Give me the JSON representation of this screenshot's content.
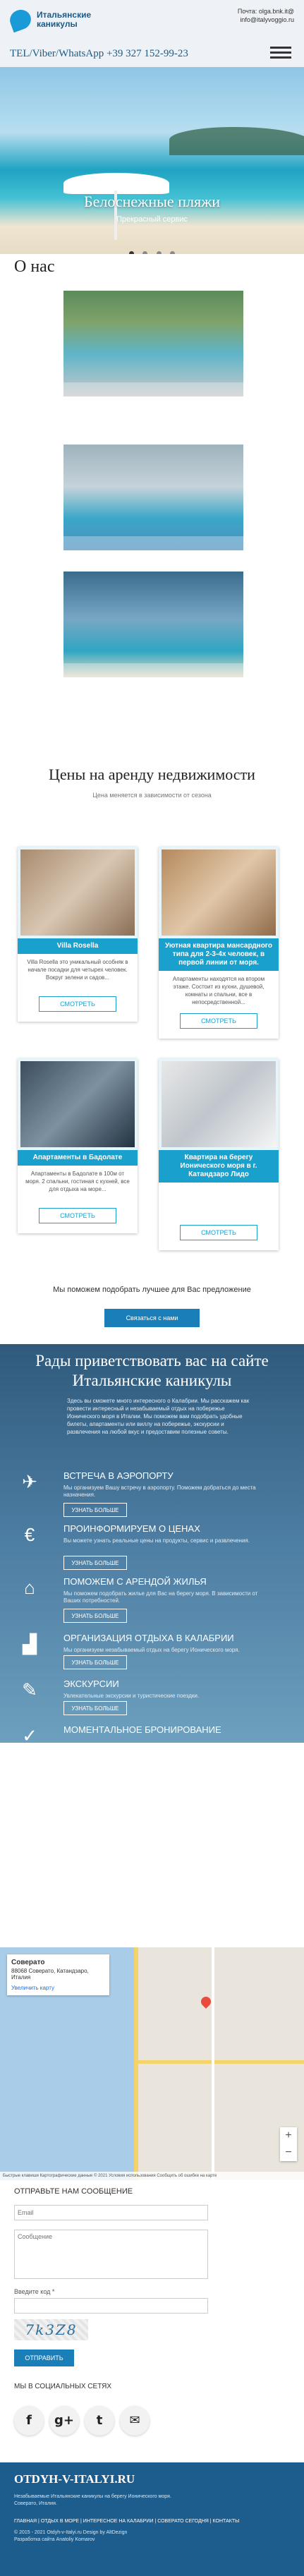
{
  "header": {
    "logo_line1": "Итальянские",
    "logo_line2": "каникулы",
    "email_label": "Почта: olga.bnk.it@",
    "email_line2": "info@italyvoggio.ru",
    "tel": "TEL/Viber/WhatsApp +39 327 152-99-23"
  },
  "hero": {
    "title": "Белоснежные пляжи",
    "subtitle": "Прекрасный сервис"
  },
  "about": {
    "title": "О нас"
  },
  "rent": {
    "title": "Цены на аренду недвижимости",
    "subtitle": "Цена меняется в зависимости от сезона",
    "cards": [
      {
        "title": "Villa Rosella",
        "text": "Villa Rosella это уникальный особняк в начале посадки для четырех человек. Вокруг зелени и садов...",
        "button": "СМОТРЕТЬ"
      },
      {
        "title": "Уютная квартира мансардного типа для 2-3-4х человек, в первой линии от моря.",
        "text": "Апартаменты находятся на втором этаже. Состоит из кухни, душевой, комнаты и спальни, все в непосредственной...",
        "button": "СМОТРЕТЬ"
      },
      {
        "title": "Апартаменты в Бадолате",
        "text": "Апартаменты в Бадолате в 100м от моря. 2 спальни, гостиная с кухней, все для отдыха на море...",
        "button": "СМОТРЕТЬ"
      },
      {
        "title": "Квартира на берегу Ионического моря в г. Катандзаро Лидо",
        "text": "",
        "button": "СМОТРЕТЬ"
      }
    ],
    "help_text": "Мы поможем подобрать лучшее для Вас предложение",
    "help_button": "Связаться с нами"
  },
  "services": {
    "title_line1": "Рады приветствовать вас на сайте",
    "title_line2": "Итальянские каникулы",
    "intro": "Здесь вы сможете много интересного о Калабрии. Мы расскажем как провести интересный и незабываемый отдых на побережье Ионического моря в Италии. Мы поможем вам подобрать удобные билеты, апартаменты или виллу на побережье, экскурсии и развлечения на любой вкус и предоставим полезные советы.",
    "items": [
      {
        "name": "ВСТРЕЧА В АЭРОПОРТУ",
        "desc": "Мы организуем Вашу встречу в аэропорту. Поможем добраться до места назначения.",
        "button": "УЗНАТЬ БОЛЬШЕ"
      },
      {
        "name": "ПРОИНФОРМИРУЕМ О ЦЕНАХ",
        "desc": "Вы можете узнать реальные цены на продукты, сервис и развлечения.",
        "button": "УЗНАТЬ БОЛЬШЕ"
      },
      {
        "name": "ПОМОЖЕМ С АРЕНДОЙ ЖИЛЬЯ",
        "desc": "Мы поможем подобрать жилье для Вас на берегу моря. В зависимости от Ваших потребностей.",
        "button": "УЗНАТЬ БОЛЬШЕ"
      },
      {
        "name": "ОРГАНИЗАЦИЯ ОТДЫХА В КАЛАБРИИ",
        "desc": "Мы организуем незабываемый отдых на берегу Ионического моря.",
        "button": "УЗНАТЬ БОЛЬШЕ"
      },
      {
        "name": "ЭКСКУРСИИ",
        "desc": "Увлекательные экскурсии и туристические поездки.",
        "button": "УЗНАТЬ БОЛЬШЕ"
      },
      {
        "name": "МОМЕНТАЛЬНОЕ БРОНИРОВАНИЕ",
        "desc": "",
        "button": ""
      }
    ]
  },
  "map": {
    "place": "Соверато",
    "address": "88068 Соверато, Катандзаро, Италия",
    "link": "Увеличить карту",
    "footer": "Быстрые клавиши   Картографические данные © 2021   Условия использования   Сообщить об ошибке на карте"
  },
  "form": {
    "title": "ОТПРАВЬТЕ НАМ СООБЩЕНИЕ",
    "email_placeholder": "Email",
    "message_placeholder": "Сообщение",
    "captcha_label": "Введите код *",
    "captcha_code": "7k3Z8",
    "send_button": "ОТПРАВИТЬ",
    "social_title": "МЫ В СОЦИАЛЬНЫХ СЕТЯХ"
  },
  "footer": {
    "site": "OTDYH-V-ITALYI.RU",
    "desc": "Незабываемые Итальянские каникулы на берегу Ионического моря. Соверато, Италия.",
    "links": "ГЛАВНАЯ | ОТДЫХ В МОРЕ | ИНТЕРЕСНОЕ НА КАЛАБРИИ | СОВЕРАТО СЕГОДНЯ | КОНТАКТЫ",
    "copy": "© 2015 - 2021 Otdyh-v-Italyi.ru Design by AltDezign",
    "dev": "Разработка сайта Anatoliy Komarov"
  },
  "colors": {
    "accent": "#1aa0cc",
    "footer": "#1c5d8e",
    "services_bg": "#2f5a7c"
  }
}
